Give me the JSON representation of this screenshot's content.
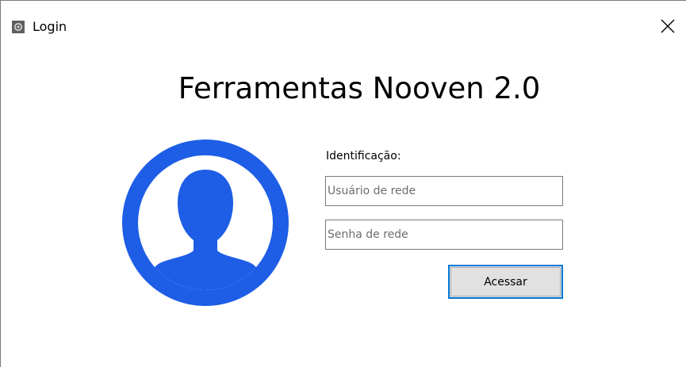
{
  "window": {
    "title": "Login",
    "app_icon": "gear-icon",
    "close_icon": "close-icon"
  },
  "main": {
    "heading": "Ferramentas Nooven 2.0",
    "avatar_icon": "user-avatar-icon",
    "identification_label": "Identificação:",
    "username_placeholder": "Usuário de rede",
    "username_value": "",
    "password_placeholder": "Senha de rede",
    "password_value": "",
    "submit_label": "Acessar"
  },
  "colors": {
    "accent": "#1e5ee6",
    "button_focus_border": "#0078d7",
    "button_bg": "#e1e1e1"
  }
}
